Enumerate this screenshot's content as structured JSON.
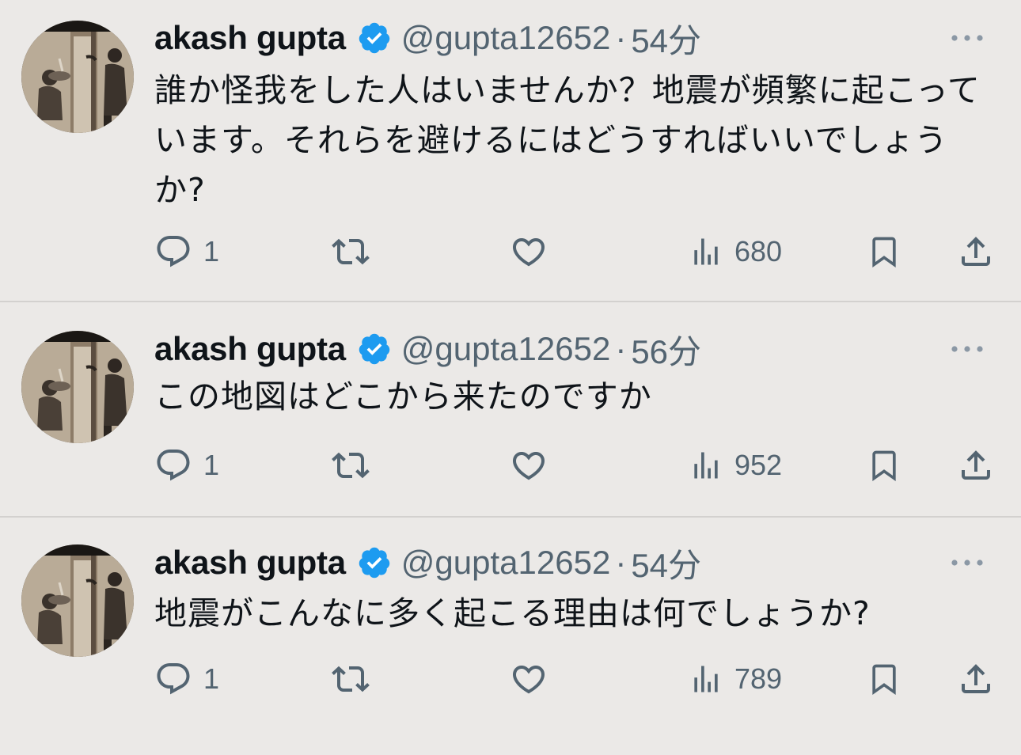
{
  "colors": {
    "background": "#ebe9e7",
    "text_primary": "#0f1419",
    "text_secondary": "#536471",
    "verified_blue": "#1d9bf0",
    "divider": "#d3d1cf"
  },
  "icons": {
    "verified": "verified-badge-icon",
    "more": "more-options-icon",
    "reply": "reply-icon",
    "retweet": "retweet-icon",
    "like": "heart-icon",
    "views": "views-bar-chart-icon",
    "bookmark": "bookmark-icon",
    "share": "share-icon"
  },
  "tweets": [
    {
      "name": "akash gupta",
      "handle": "@gupta12652",
      "separator": "·",
      "time": "54分",
      "text": "誰か怪我をした人はいませんか？地震が頻繁に起こっています。それらを避けるにはどうすればいいでしょうか?",
      "replies": "1",
      "views": "680"
    },
    {
      "name": "akash gupta",
      "handle": "@gupta12652",
      "separator": "·",
      "time": "56分",
      "text": "この地図はどこから来たのですか",
      "replies": "1",
      "views": "952"
    },
    {
      "name": "akash gupta",
      "handle": "@gupta12652",
      "separator": "·",
      "time": "54分",
      "text": "地震がこんなに多く起こる理由は何でしょうか?",
      "replies": "1",
      "views": "789"
    }
  ]
}
